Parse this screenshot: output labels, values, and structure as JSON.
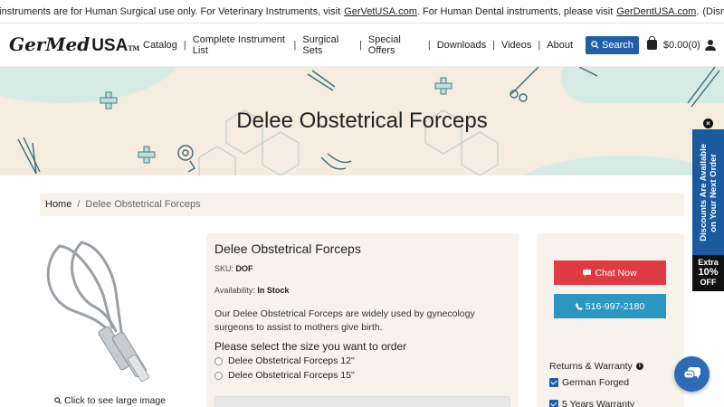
{
  "notice": {
    "text_before": "Our instruments are for Human Surgical use only. For Veterinary Instruments, visit",
    "vet_link": "GerVetUSA.com",
    "text_middle": ". For Human Dental instruments, please visit",
    "dent_link": "GerDentUSA.com",
    "text_after": ".",
    "dismiss": "(Dismiss)"
  },
  "header": {
    "logo_main": "GerMed",
    "logo_usa": "USA",
    "logo_tm": "TM",
    "nav": [
      "Catalog",
      "Complete Instrument List",
      "Surgical Sets",
      "Special Offers",
      "Downloads",
      "Videos",
      "About"
    ],
    "search_label": "Search",
    "cart_total": "$0.00",
    "cart_count": "(0)"
  },
  "hero": {
    "title": "Delee Obstetrical Forceps"
  },
  "breadcrumb": {
    "home": "Home",
    "separator": "/",
    "current": "Delee Obstetrical Forceps"
  },
  "product": {
    "title": "Delee Obstetrical Forceps",
    "sku_label": "SKU:",
    "sku": "DOF",
    "availability_label": "Availability:",
    "availability": "In Stock",
    "description": "Our Delee Obstetrical Forceps are widely used by gynecology surgeons to assist to mothers give birth.",
    "select_title": "Please select the size you want to order",
    "options": [
      "Delee Obstetrical Forceps 12\"",
      "Delee Obstetrical Forceps 15\""
    ],
    "enlarge_text": "Click to see large image"
  },
  "side": {
    "chat_label": "Chat Now",
    "phone_label": "516-997-2180",
    "returns_label": "Returns & Warranty",
    "features": [
      "German Forged",
      "5 Years Warranty"
    ]
  },
  "discount": {
    "line1": "Discounts Are Available",
    "line2": "on Your Next Order",
    "extra1": "Extra",
    "extra2": "10%",
    "extra3": "OFF",
    "close": "×"
  },
  "colors": {
    "brand_blue": "#1f5fa8",
    "chat_red": "#e03a42",
    "phone_blue": "#2b96c2",
    "hero_bg": "#f3ecdf"
  }
}
